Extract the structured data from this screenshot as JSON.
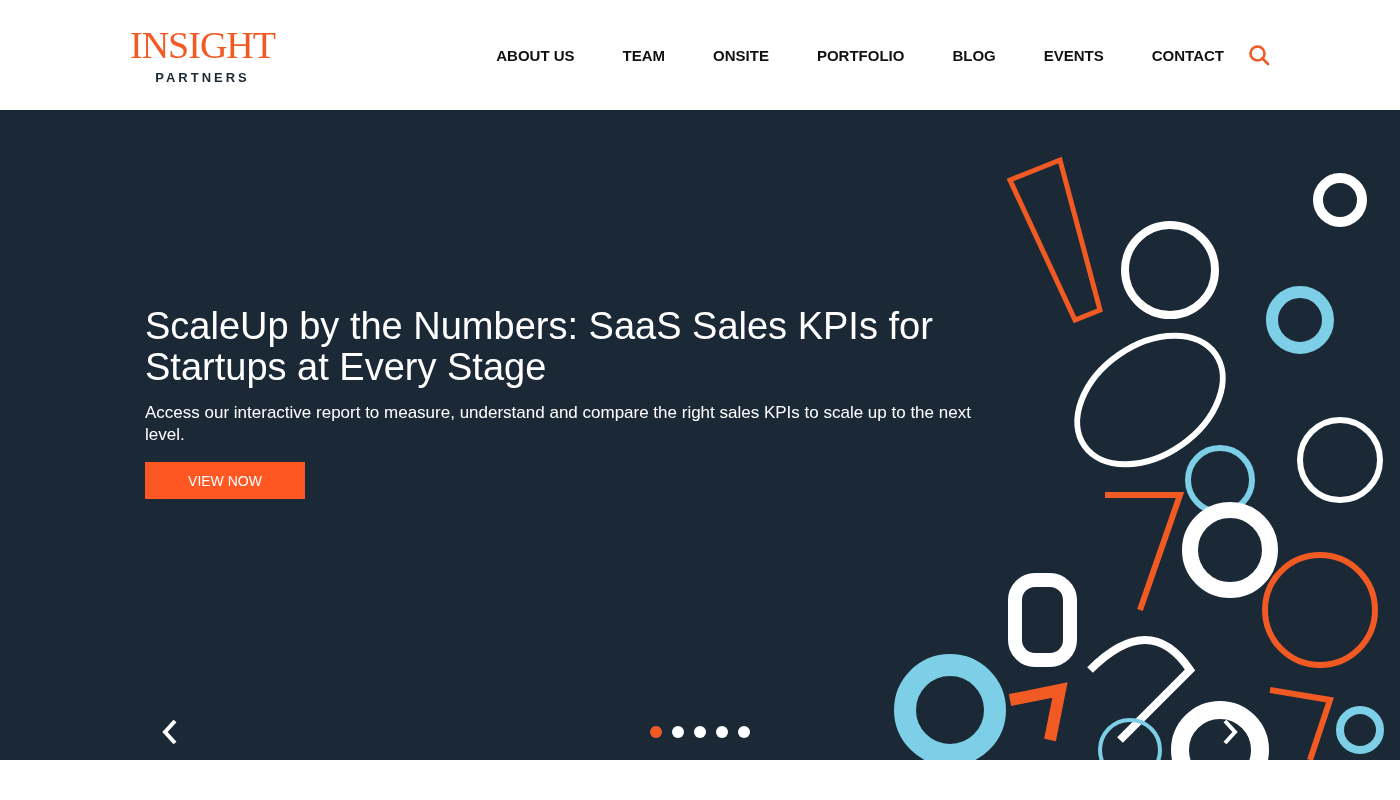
{
  "logo": {
    "wordmark": "INSIGHT",
    "subtitle": "PARTNERS"
  },
  "nav": [
    {
      "label": "ABOUT US"
    },
    {
      "label": "TEAM"
    },
    {
      "label": "ONSITE"
    },
    {
      "label": "PORTFOLIO"
    },
    {
      "label": "BLOG"
    },
    {
      "label": "EVENTS"
    },
    {
      "label": "CONTACT"
    }
  ],
  "hero": {
    "title": "ScaleUp by the Numbers: SaaS Sales KPIs for Startups at Every Stage",
    "text": "Access our interactive report to measure, understand and compare the right sales KPIs to scale up to the next level.",
    "button": "VIEW NOW"
  },
  "slides": [
    {
      "selected": true
    },
    {
      "selected": false
    },
    {
      "selected": false
    },
    {
      "selected": false
    },
    {
      "selected": false
    }
  ]
}
